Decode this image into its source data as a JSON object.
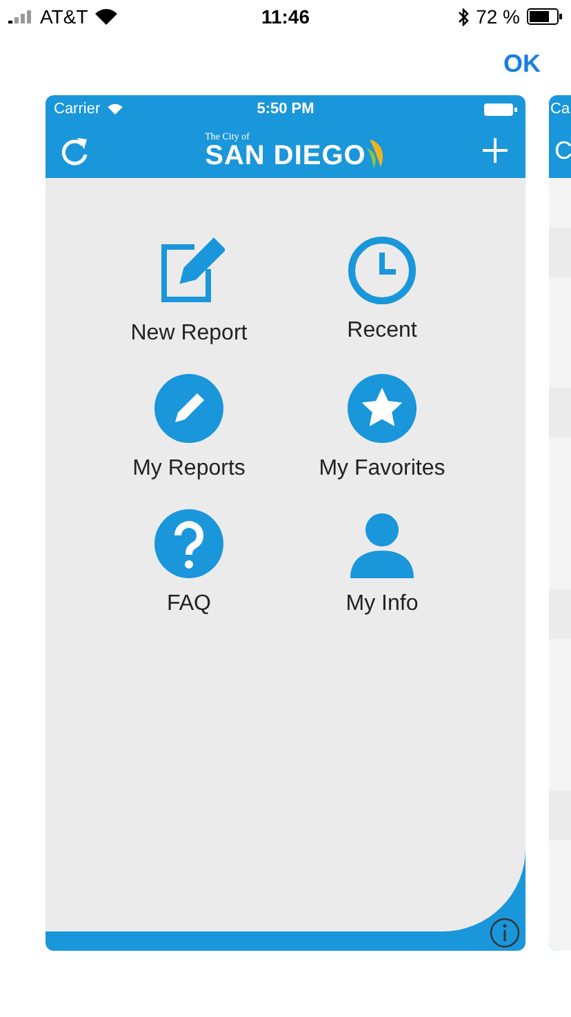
{
  "status_bar": {
    "carrier": "AT&T",
    "time": "11:46",
    "battery": "72 %"
  },
  "done_button": "OK",
  "screens": [
    {
      "status": {
        "carrier": "Carrier",
        "time": "5:50 PM"
      },
      "logo": {
        "small": "The City of",
        "large": "SAN DIEGO"
      },
      "tiles": [
        {
          "kind": "new",
          "label": "New Report"
        },
        {
          "kind": "recent",
          "label": "Recent"
        },
        {
          "kind": "reports",
          "label": "My Reports"
        },
        {
          "kind": "favorites",
          "label": "My Favorites"
        },
        {
          "kind": "faq",
          "label": "FAQ"
        },
        {
          "kind": "info",
          "label": "My Info"
        }
      ]
    },
    {
      "status": {
        "carrier": "Ca"
      },
      "nav_text": "C"
    }
  ]
}
